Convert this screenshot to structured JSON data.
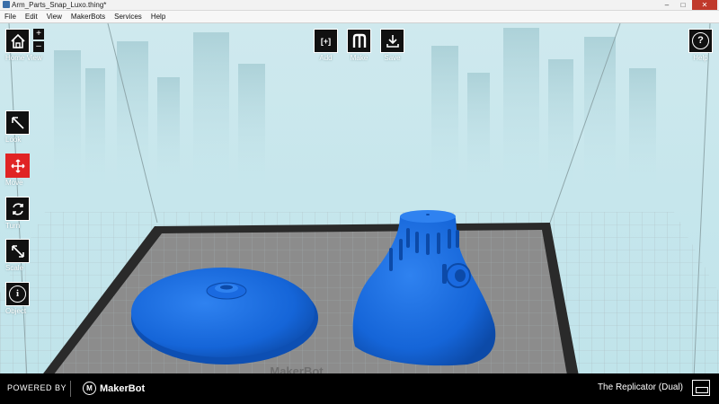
{
  "window": {
    "title": "Arm_Parts_Snap_Luxo.thing*",
    "minimize": "–",
    "maximize": "□",
    "close": "✕"
  },
  "menu": [
    "File",
    "Edit",
    "View",
    "MakerBots",
    "Services",
    "Help"
  ],
  "toolbar": {
    "home_view": "Home View",
    "zoom_in": "+",
    "zoom_out": "–",
    "add": "Add",
    "add_icon_text": "[+]",
    "make": "Make",
    "save": "Save",
    "help": "Help",
    "help_icon_text": "?"
  },
  "side_tools": {
    "look": "Look",
    "move": "Move",
    "turn": "Turn",
    "scale": "Scale",
    "object": "Object",
    "object_icon_text": "i"
  },
  "plate": {
    "brand": "MakerBot"
  },
  "footer": {
    "powered_by": "POWERED BY",
    "logo_initial": "M",
    "logo_word": "MakerBot",
    "printer": "The Replicator (Dual)"
  },
  "colors": {
    "model": "#1565d8",
    "active_tool": "#e02424",
    "sky": "#bfe3ea"
  }
}
